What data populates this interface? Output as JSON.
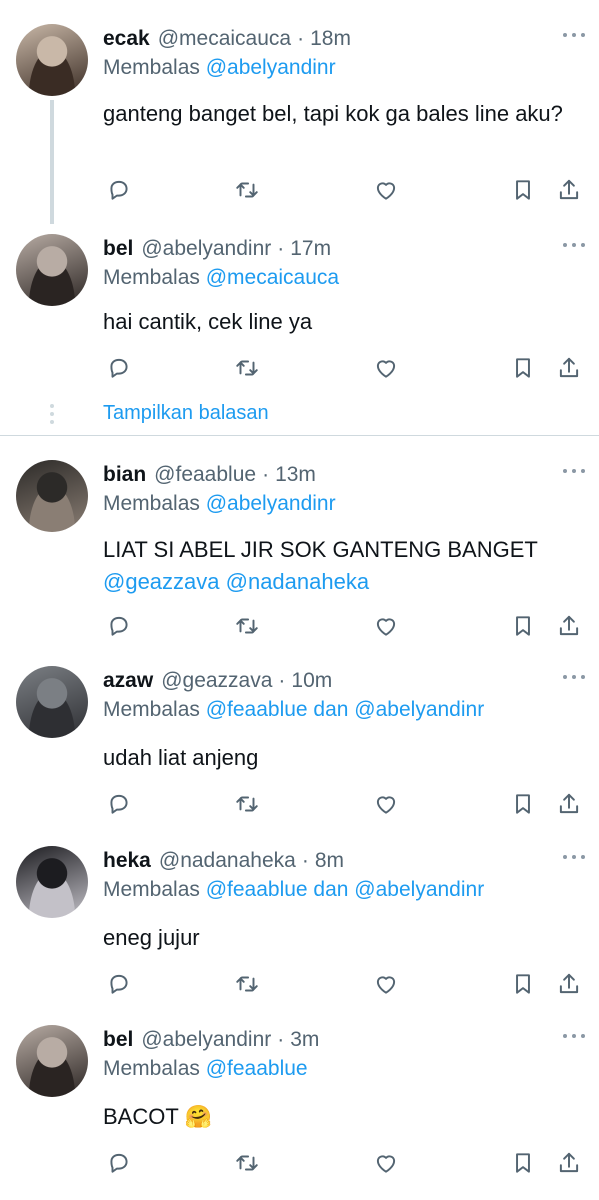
{
  "tweets": [
    {
      "name": "ecak",
      "handle": "@mecaicauca",
      "time": "18m",
      "reply_prefix": "Membalas ",
      "reply_to": "@abelyandinr",
      "text": "ganteng banget bel, tapi kok ga bales line aku?",
      "avatar_colors": [
        "#c9b8a8",
        "#3a2c24"
      ]
    },
    {
      "name": "bel",
      "handle": "@abelyandinr",
      "time": "17m",
      "reply_prefix": "Membalas ",
      "reply_to": "@mecaicauca",
      "text": "hai cantik, cek line ya",
      "avatar_colors": [
        "#b8aca4",
        "#2a2422"
      ]
    },
    {
      "name": "bian",
      "handle": "@feaablue",
      "time": "13m",
      "reply_prefix": "Membalas ",
      "reply_to": "@abelyandinr",
      "text": "LIAT SI ABEL JIR SOK GANTENG BANGET",
      "text_mentions": "@geazzava @nadanaheka",
      "avatar_colors": [
        "#2c2a28",
        "#8a7e74"
      ]
    },
    {
      "name": "azaw",
      "handle": "@geazzava",
      "time": "10m",
      "reply_prefix": "Membalas ",
      "reply_to": "@feaablue dan @abelyandinr",
      "text": "udah liat anjeng",
      "avatar_colors": [
        "#7b7f84",
        "#2e2f33"
      ]
    },
    {
      "name": "heka",
      "handle": "@nadanaheka",
      "time": "8m",
      "reply_prefix": "Membalas ",
      "reply_to": "@feaablue dan @abelyandinr",
      "text": "eneg jujur",
      "avatar_colors": [
        "#1c1c20",
        "#c3c1c8"
      ]
    },
    {
      "name": "bel",
      "handle": "@abelyandinr",
      "time": "3m",
      "reply_prefix": "Membalas ",
      "reply_to": "@feaablue",
      "text": "BACOT 🤗",
      "avatar_colors": [
        "#b8aca4",
        "#2a2422"
      ]
    }
  ],
  "show_replies_label": "Tampilkan balasan",
  "icons": [
    "reply-icon",
    "retweet-icon",
    "like-icon",
    "bookmark-icon",
    "share-icon",
    "more-icon"
  ],
  "colors": {
    "accent": "#1d9bf0",
    "secondary_text": "#536471",
    "icon": "#536471",
    "divider": "#cfd9de"
  }
}
